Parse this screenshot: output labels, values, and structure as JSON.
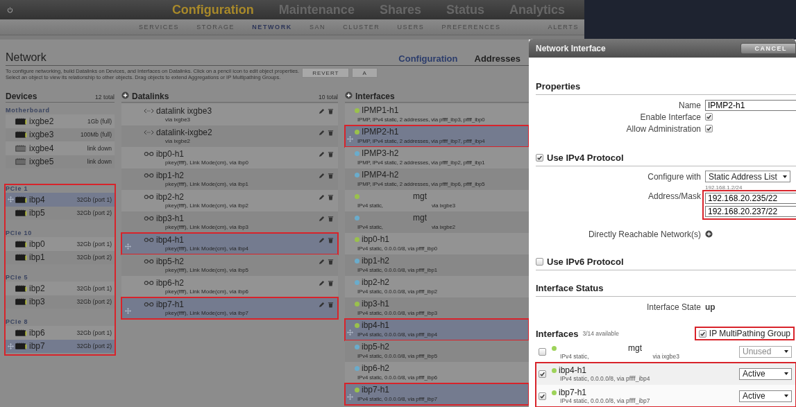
{
  "nav": {
    "tabs": [
      {
        "label": "Configuration",
        "selected": true
      },
      {
        "label": "Maintenance",
        "selected": false
      },
      {
        "label": "Shares",
        "selected": false
      },
      {
        "label": "Status",
        "selected": false
      },
      {
        "label": "Analytics",
        "selected": false
      }
    ],
    "subtabs": [
      {
        "label": "SERVICES",
        "selected": false
      },
      {
        "label": "STORAGE",
        "selected": false
      },
      {
        "label": "NETWORK",
        "selected": true
      },
      {
        "label": "SAN",
        "selected": false
      },
      {
        "label": "CLUSTER",
        "selected": false
      },
      {
        "label": "USERS",
        "selected": false
      },
      {
        "label": "PREFERENCES",
        "selected": false
      },
      {
        "label": "ALERTS",
        "selected": false
      }
    ]
  },
  "page": {
    "title": "Network",
    "views": [
      {
        "label": "Configuration",
        "selected": true
      },
      {
        "label": "Addresses",
        "selected": false
      }
    ],
    "description": [
      "To configure networking, build Datalinks on Devices, and Interfaces on Datalinks. Click on a pencil icon to edit object properties.",
      "Select an object to view its relationship to other objects. Drag objects to extend Aggregations or IP Multipathing Groups."
    ],
    "buttons": [
      "REVERT",
      "A"
    ]
  },
  "devices": {
    "title": "Devices",
    "count": "12 total",
    "groups": [
      {
        "label": "Motherboard",
        "outlined": false,
        "items": [
          {
            "name": "ixgbe2",
            "speed": "1Gb (full)",
            "link_up": true,
            "selected": false
          },
          {
            "name": "ixgbe3",
            "speed": "100Mb (full)",
            "link_up": true,
            "selected": false
          },
          {
            "name": "ixgbe4",
            "speed": "link down",
            "link_up": false,
            "selected": false
          },
          {
            "name": "ixgbe5",
            "speed": "link down",
            "link_up": false,
            "selected": false
          }
        ]
      },
      {
        "label": "PCIe 1",
        "outlined": true,
        "items": [
          {
            "name": "ibp4",
            "speed": "32Gb (port 1)",
            "link_up": true,
            "selected": true
          },
          {
            "name": "ibp5",
            "speed": "32Gb (port 2)",
            "link_up": true,
            "selected": false
          }
        ]
      },
      {
        "label": "PCIe 10",
        "outlined": true,
        "items": [
          {
            "name": "ibp0",
            "speed": "32Gb (port 1)",
            "link_up": true,
            "selected": false
          },
          {
            "name": "ibp1",
            "speed": "32Gb (port 2)",
            "link_up": true,
            "selected": false
          }
        ]
      },
      {
        "label": "PCIe 5",
        "outlined": true,
        "items": [
          {
            "name": "ibp2",
            "speed": "32Gb (port 1)",
            "link_up": true,
            "selected": false
          },
          {
            "name": "ibp3",
            "speed": "32Gb (port 2)",
            "link_up": true,
            "selected": false
          }
        ]
      },
      {
        "label": "PCIe 8",
        "outlined": true,
        "items": [
          {
            "name": "ibp6",
            "speed": "32Gb (port 1)",
            "link_up": true,
            "selected": false
          },
          {
            "name": "ibp7",
            "speed": "32Gb (port 2)",
            "link_up": true,
            "selected": true
          }
        ]
      }
    ]
  },
  "datalinks": {
    "title": "Datalinks",
    "count": "10 total",
    "items": [
      {
        "kind": "device",
        "name": "datalink ixgbe3",
        "detail": "via ixgbe3",
        "selected": false
      },
      {
        "kind": "device",
        "name": "datalink-ixgbe2",
        "detail": "via ixgbe2",
        "selected": false
      },
      {
        "kind": "ib",
        "name": "ibp0-h1",
        "detail": "pkey(ffff), Link Mode(cm), via ibp0",
        "selected": false
      },
      {
        "kind": "ib",
        "name": "ibp1-h2",
        "detail": "pkey(ffff), Link Mode(cm), via ibp1",
        "selected": false
      },
      {
        "kind": "ib",
        "name": "ibp2-h2",
        "detail": "pkey(ffff), Link Mode(cm), via ibp2",
        "selected": false
      },
      {
        "kind": "ib",
        "name": "ibp3-h1",
        "detail": "pkey(ffff), Link Mode(cm), via ibp3",
        "selected": false
      },
      {
        "kind": "ib",
        "name": "ibp4-h1",
        "detail": "pkey(ffff), Link Mode(cm), via ibp4",
        "selected": true
      },
      {
        "kind": "ib",
        "name": "ibp5-h2",
        "detail": "pkey(ffff), Link Mode(cm), via ibp5",
        "selected": false
      },
      {
        "kind": "ib",
        "name": "ibp6-h2",
        "detail": "pkey(ffff), Link Mode(cm), via ibp6",
        "selected": false
      },
      {
        "kind": "ib",
        "name": "ibp7-h1",
        "detail": "pkey(ffff), Link Mode(cm), via ibp7",
        "selected": true
      }
    ]
  },
  "interfaces": {
    "title": "Interfaces",
    "items": [
      {
        "name": "IPMP1-h1",
        "color": "#9ac14c",
        "details": [
          "IPMP, IPv4 static, 2 addresses, via pffff_ibp3, pffff_ibp0"
        ],
        "selected": false
      },
      {
        "name": "IPMP2-h1",
        "color": "#9ac14c",
        "details": [
          "IPMP, IPv4 static, 2 addresses, via pffff_ibp7, pffff_ibp4"
        ],
        "selected": true
      },
      {
        "name": "IPMP3-h2",
        "color": "#6aaccc",
        "details": [
          "IPMP, IPv4 static, 2 addresses, via pffff_ibp2, pffff_ibp1"
        ],
        "selected": false
      },
      {
        "name": "IPMP4-h2",
        "color": "#6aaccc",
        "details": [
          "IPMP, IPv4 static, 2 addresses, via pffff_ibp6, pffff_ibp5"
        ],
        "selected": false
      },
      {
        "name": "mgt",
        "color": "#9ac14c",
        "details": [
          "IPv4 static,",
          "via ixgbe3"
        ],
        "selected": false
      },
      {
        "name": "mgt",
        "color": "#6aaccc",
        "details": [
          "IPv4 static,",
          "via ixgbe2"
        ],
        "selected": false
      },
      {
        "name": "ibp0-h1",
        "color": "#9ac14c",
        "details": [
          "IPv4 static, 0.0.0.0/8, via pffff_ibp0"
        ],
        "selected": false
      },
      {
        "name": "ibp1-h2",
        "color": "#6aaccc",
        "details": [
          "IPv4 static, 0.0.0.0/8, via pffff_ibp1"
        ],
        "selected": false
      },
      {
        "name": "ibp2-h2",
        "color": "#6aaccc",
        "details": [
          "IPv4 static, 0.0.0.0/8, via pffff_ibp2"
        ],
        "selected": false
      },
      {
        "name": "ibp3-h1",
        "color": "#9ac14c",
        "details": [
          "IPv4 static, 0.0.0.0/8, via pffff_ibp3"
        ],
        "selected": false
      },
      {
        "name": "ibp4-h1",
        "color": "#9ac14c",
        "details": [
          "IPv4 static, 0.0.0.0/8, via pffff_ibp4"
        ],
        "selected": true
      },
      {
        "name": "ibp5-h2",
        "color": "#6aaccc",
        "details": [
          "IPv4 static, 0.0.0.0/8, via pffff_ibp5"
        ],
        "selected": false
      },
      {
        "name": "ibp6-h2",
        "color": "#6aaccc",
        "details": [
          "IPv4 static, 0.0.0.0/8, via pffff_ibp6"
        ],
        "selected": false
      },
      {
        "name": "ibp7-h1",
        "color": "#9ac14c",
        "details": [
          "IPv4 static, 0.0.0.0/8, via pffff_ibp7"
        ],
        "selected": true
      }
    ]
  },
  "dialog": {
    "title": "Network Interface",
    "cancel": "CANCEL",
    "properties": {
      "title": "Properties",
      "name_label": "Name",
      "name_value": "IPMP2-h1",
      "enable_label": "Enable Interface",
      "enable_checked": true,
      "admin_label": "Allow Administration",
      "admin_checked": true
    },
    "ipv4": {
      "title": "Use IPv4 Protocol",
      "checked": true,
      "configure_label": "Configure with",
      "configure_value": "Static Address List",
      "address_label": "Address/Mask",
      "address_hint": "192.168.1.2/24",
      "addresses": [
        "192.168.20.235/22",
        "192.168.20.237/22"
      ],
      "addresses_annotated": true,
      "reachable_label": "Directly Reachable Network(s)"
    },
    "ipv6": {
      "title": "Use IPv6 Protocol",
      "checked": false
    },
    "status": {
      "title": "Interface Status",
      "state_label": "Interface State",
      "state_value": "up"
    },
    "members": {
      "title": "Interfaces",
      "count": "3/14 available",
      "ipmp_label": "IP MultiPathing Group",
      "ipmp_checked": true,
      "ipmp_annotated": true,
      "items": [
        {
          "name": "mgt",
          "color": "#9ed35a",
          "details": [
            "IPv4 static,",
            "via ixgbe3"
          ],
          "checked": false,
          "role": "Unused",
          "annotated": false
        },
        {
          "name": "ibp4-h1",
          "color": "#9ed35a",
          "details": [
            "IPv4 static, 0.0.0.0/8, via pffff_ibp4"
          ],
          "checked": true,
          "role": "Active",
          "annotated": true
        },
        {
          "name": "ibp7-h1",
          "color": "#9ed35a",
          "details": [
            "IPv4 static, 0.0.0.0/8, via pffff_ibp7"
          ],
          "checked": true,
          "role": "Active",
          "annotated": true
        }
      ]
    }
  }
}
